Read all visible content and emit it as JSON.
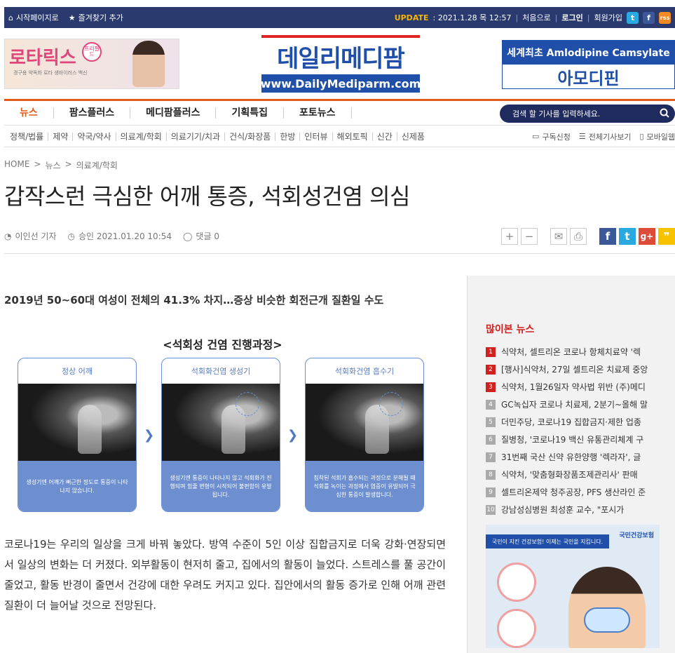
{
  "topbar": {
    "home_link": "시작페이지로",
    "bookmark": "즐겨찾기 추가",
    "update_label": "UPDATE",
    "update_time": ": 2021.1.28 목 12:57",
    "home": "처음으로",
    "login": "로그인",
    "signup": "회원가입",
    "social": [
      "t",
      "f",
      "rss"
    ]
  },
  "header": {
    "ad_left_brand": "로타릭스",
    "ad_left_badge": "프리필드",
    "ad_left_sub": "경구용 약독화 로타 생바이러스 백신",
    "logo_kr": "데일리메디팜",
    "logo_url": "www.DailyMediparm.com",
    "ad_right_top": "세계최초 Amlodipine Camsylate",
    "ad_right_bottom": "아모디핀"
  },
  "nav": {
    "items": [
      "뉴스",
      "팜스플러스",
      "메디팜플러스",
      "기획특집",
      "포토뉴스"
    ],
    "search_placeholder": "검색 할 기사를 입력하세요."
  },
  "subnav": {
    "items": [
      "정책/법률",
      "제약",
      "약국/약사",
      "의료계/학회",
      "의료기기/치과",
      "건식/화장품",
      "한방",
      "인터뷰",
      "해외토픽",
      "신간",
      "신제품"
    ],
    "tools": [
      "구독신청",
      "전체기사보기",
      "모바일웹"
    ]
  },
  "breadcrumb": [
    "HOME",
    "뉴스",
    "의료계/학회"
  ],
  "article": {
    "title": "갑작스런 극심한 어깨 통증, 석회성건염 의심",
    "author": "이인선 기자",
    "approved": "승인 2021.01.20 10:54",
    "comments": "댓글 0",
    "subtitle": "2019년 50~60대 여성이 전체의 41.3% 차지…증상 비슷한 회전근개 질환일 수도",
    "body": "코로나19는 우리의 일상을 크게 바꿔 놓았다. 방역 수준이 5인 이상 집합금지로 더욱 강화·연장되면서 일상의 변화는 더 커졌다. 외부활동이 현저히 줄고, 집에서의 활동이 늘었다. 스트레스를 풀 공간이 줄었고, 활동 반경이 줄면서 건강에 대한 우려도 커지고 있다. 집안에서의 활동 증가로 인해 어깨 관련 질환이 더 늘어날 것으로 전망된다."
  },
  "diagram": {
    "title": "<석회성 건염 진행과정>",
    "panels": [
      {
        "head": "정상 어깨",
        "desc": "생성기엔 어깨가 뻐근한 정도로 통증이 나타나지 않습니다."
      },
      {
        "head": "석회화건염 생성기",
        "desc": "생성기엔 통증이 나타나지 않고 석회화가 진행되며 힘줄 변형이 시작되어 불편함이 유발됩니다."
      },
      {
        "head": "석회화건염 흡수기",
        "desc": "침착된 석회가 흡수되는 과정으로 분해될 때 석회를 녹이는 과정에서 염증이 유발되어 극심한 통증이 발생합니다."
      }
    ]
  },
  "sidebar": {
    "popular_title": "많이본 뉴스",
    "popular": [
      "식약처, 셀트리온 코로나 항체치료약 '렉",
      "[행사]식약처, 27일 셀트리온 치료제 중앙",
      "식약처, 1월26일자 약사법 위반 (주)메디",
      "GC녹십자 코로나 치료제, 2분기~올해 말",
      "더민주당, 코로나19 집합금지·제한 업종",
      "질병청, '코로나19 백신 유통관리체계 구",
      "31번째 국산 신약 유한양행 '렉라자', 글",
      "식약처, '맞춤형화장품조제관리사' 판매",
      "셀트리온제약 청주공장, PFS 생산라인 준",
      "강남성심병원 최성훈 교수, \"포시가"
    ],
    "banner_top": "국민이 지킨 건강보험! 이제는 국민을 지킵니다.",
    "banner_logo": "국민건강보험"
  }
}
